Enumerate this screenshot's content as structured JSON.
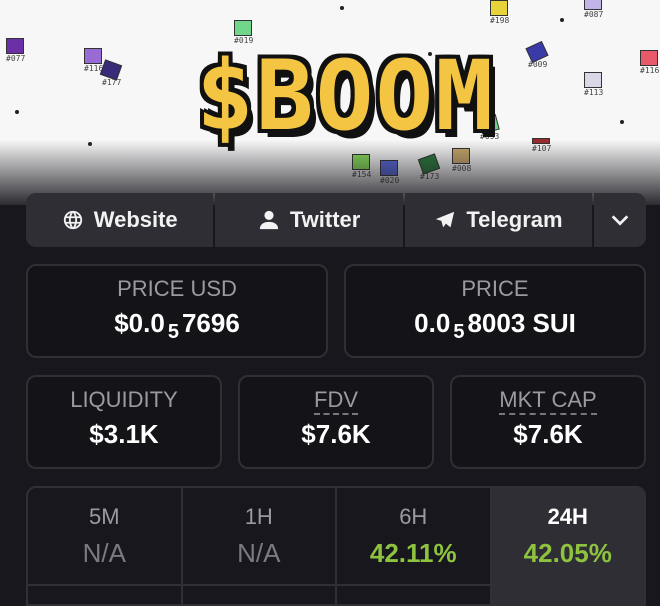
{
  "banner": {
    "logo_text": "$BOOM",
    "sprites": [
      {
        "tag": "#077",
        "color": "#6b2fa8"
      },
      {
        "tag": "#116",
        "color": "#9a6ad6"
      },
      {
        "tag": "#177",
        "color": "#3a2a7a"
      },
      {
        "tag": "#019",
        "color": "#6fd68a"
      },
      {
        "tag": "#198",
        "color": "#e8d33a"
      },
      {
        "tag": "#087",
        "color": "#c0b4e8"
      },
      {
        "tag": "#009",
        "color": "#3a3aa8"
      },
      {
        "tag": "#113",
        "color": "#d8d8e8"
      },
      {
        "tag": "#116",
        "color": "#e85a6a"
      },
      {
        "tag": "#093",
        "color": "#6ad68a"
      },
      {
        "tag": "#107",
        "color": "#9a2a2a"
      },
      {
        "tag": "#154",
        "color": "#8ae05a"
      },
      {
        "tag": "#020",
        "color": "#5a6ae0"
      },
      {
        "tag": "#173",
        "color": "#2a7a3a"
      },
      {
        "tag": "#008",
        "color": "#c8a86a"
      }
    ]
  },
  "links": {
    "website": "Website",
    "twitter": "Twitter",
    "telegram": "Telegram"
  },
  "price_usd": {
    "label": "PRICE USD",
    "prefix": "$0.0",
    "zeros": "5",
    "digits": "7696"
  },
  "price_native": {
    "label": "PRICE",
    "prefix": "0.0",
    "zeros": "5",
    "digits": "8003 SUI"
  },
  "liquidity": {
    "label": "LIQUIDITY",
    "value": "$3.1K"
  },
  "fdv": {
    "label": "FDV",
    "value": "$7.6K"
  },
  "mkt_cap": {
    "label": "MKT CAP",
    "value": "$7.6K"
  },
  "timeframes": [
    {
      "period": "5M",
      "value": "N/A"
    },
    {
      "period": "1H",
      "value": "N/A"
    },
    {
      "period": "6H",
      "value": "42.11%"
    },
    {
      "period": "24H",
      "value": "42.05%"
    }
  ]
}
